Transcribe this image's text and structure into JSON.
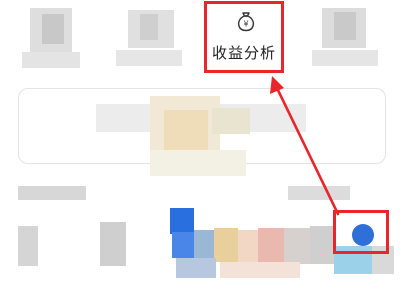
{
  "shortcut": {
    "label": "收益分析",
    "icon": "money-bag-yen-icon",
    "icon_glyph": "¥"
  },
  "annotation": {
    "color": "#e8262b"
  },
  "accent": {
    "blue": "#2f6fd8"
  }
}
